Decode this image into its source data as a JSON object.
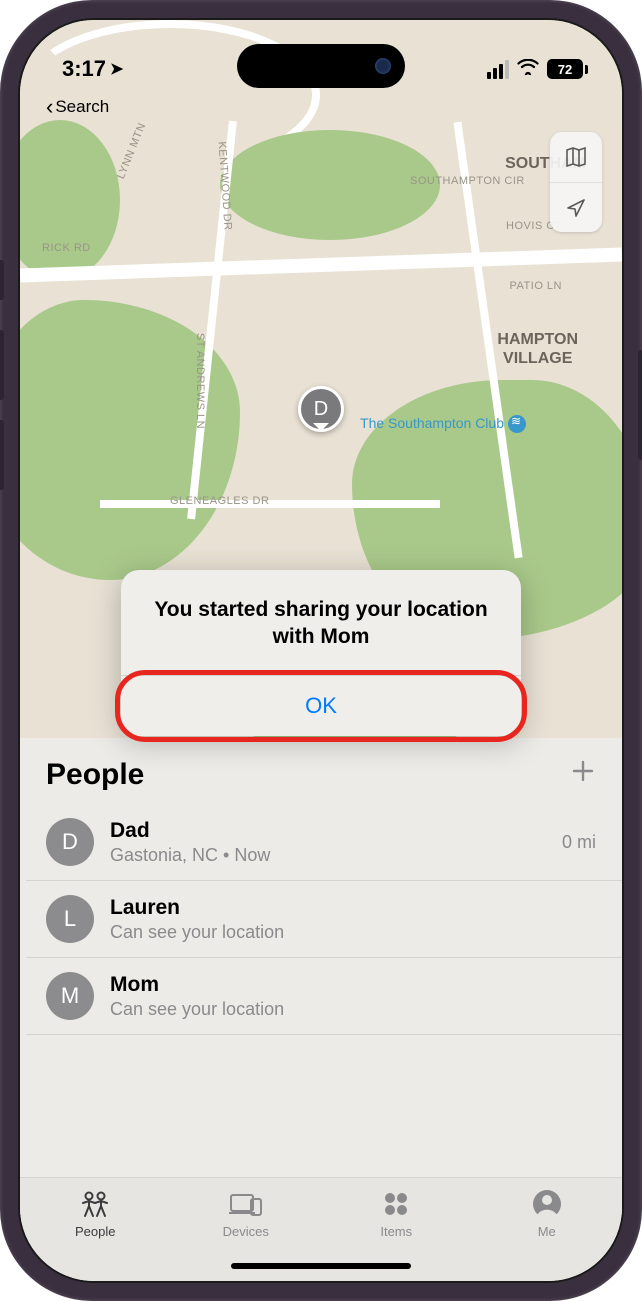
{
  "status": {
    "time": "3:17",
    "battery_pct": "72"
  },
  "nav": {
    "back_label": "Search"
  },
  "map": {
    "pin_initial": "D",
    "roads": {
      "lynn_mtn": "LYNN MTN",
      "kentwood": "KENTWOOD DR",
      "rick_rd": "RICK RD",
      "southampton_cir": "SOUTHAMPTON CIR",
      "hovis": "HOVIS CT",
      "patio": "PATIO LN",
      "st_andrews": "ST ANDREWS LN",
      "gleneagles": "GLENEAGLES DR"
    },
    "places": {
      "southam": "SOUTHAM",
      "hampton": "HAMPTON\nVILLAGE"
    },
    "poi": {
      "southampton_club": "The Southampton Club"
    }
  },
  "alert": {
    "message": "You started sharing your location with Mom",
    "ok_label": "OK"
  },
  "sheet": {
    "title": "People",
    "people": [
      {
        "initial": "D",
        "name": "Dad",
        "sub": "Gastonia, NC • Now",
        "dist": "0 mi"
      },
      {
        "initial": "L",
        "name": "Lauren",
        "sub": "Can see your location",
        "dist": ""
      },
      {
        "initial": "M",
        "name": "Mom",
        "sub": "Can see your location",
        "dist": ""
      }
    ]
  },
  "tabs": {
    "people": "People",
    "devices": "Devices",
    "items": "Items",
    "me": "Me"
  }
}
